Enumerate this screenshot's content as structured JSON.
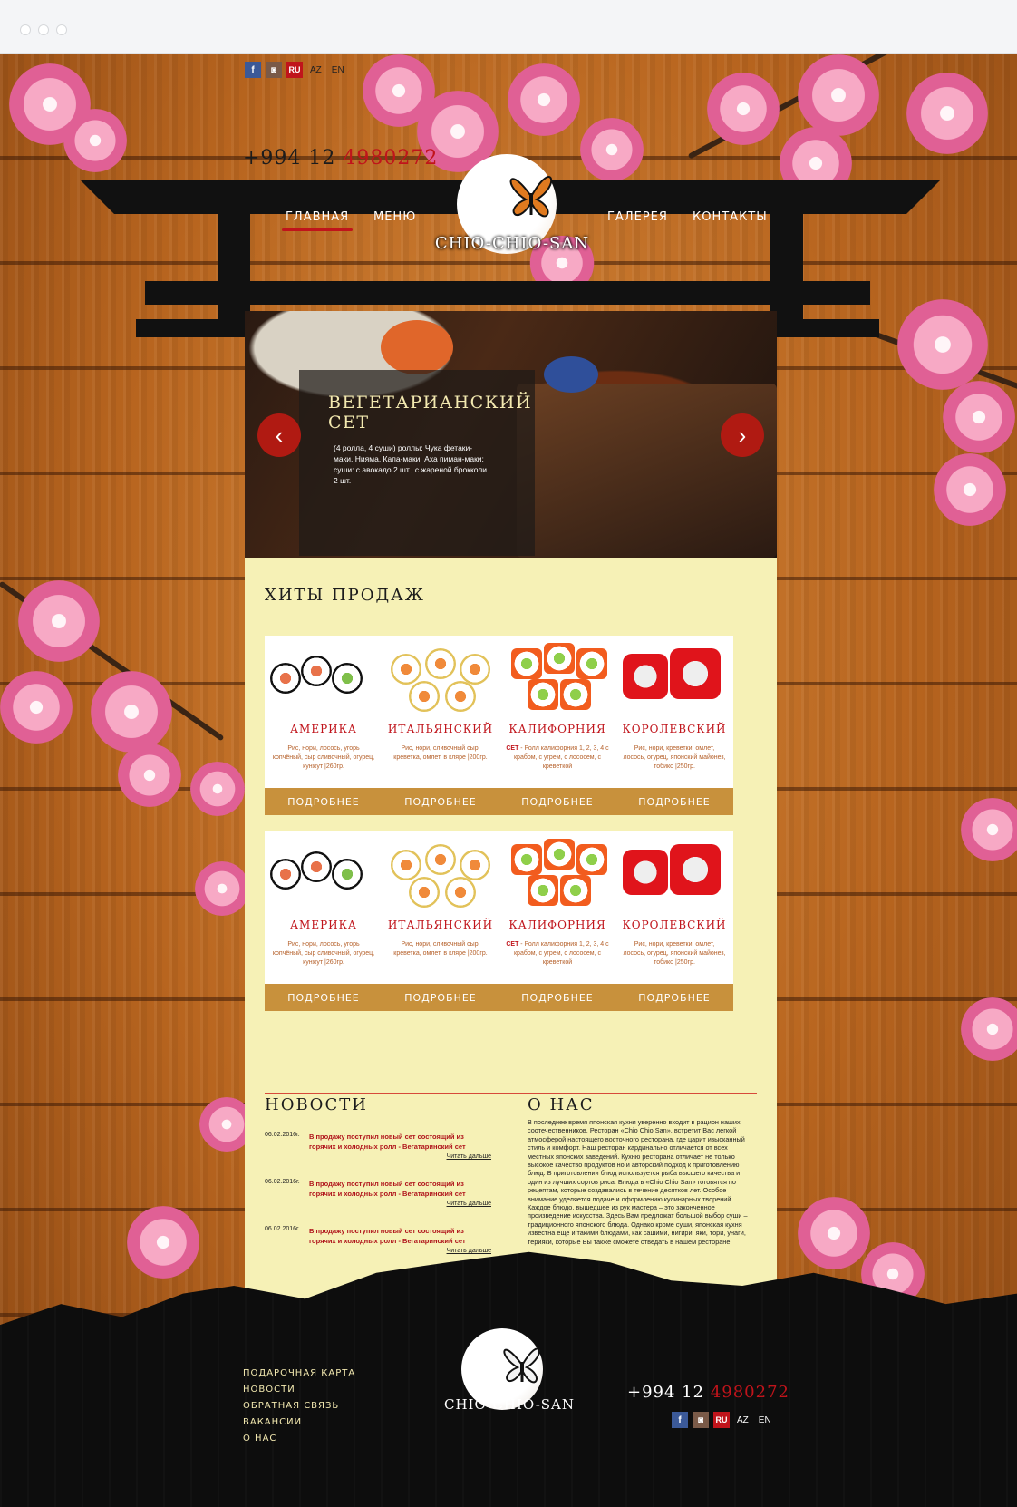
{
  "header": {
    "social": [
      "f",
      "◙"
    ],
    "languages": [
      "RU",
      "AZ",
      "EN"
    ],
    "phone_prefix": "+994 12",
    "phone_number": "4980272",
    "brand": "CHIO-CHIO-SAN",
    "nav": [
      "ГЛАВНАЯ",
      "МЕНЮ",
      "ГАЛЕРЕЯ",
      "КОНТАКТЫ"
    ]
  },
  "slider": {
    "title": "ВЕГЕТАРИАНСКИЙ СЕТ",
    "description": "(4 ролла, 4 суши) роллы: Чука фетаки-маки, Нияма, Капа-маки, Аха пиман-маки; суши: с авокадо 2 шт., с жареной брокколи 2 шт.",
    "prev_icon": "‹",
    "next_icon": "›"
  },
  "bestsellers": {
    "title": "ХИТЫ ПРОДАЖ",
    "button_label": "ПОДРОБНЕЕ",
    "items": [
      {
        "name": "АМЕРИКА",
        "desc": "Рис, нори, лосось, угорь копчёный, сыр сливочный, огурец, кунжут |260гр."
      },
      {
        "name": "ИТАЛЬЯНСКИЙ",
        "desc": "Рис, нори, сливочный сыр, креветка, омлет, в кляре |200гр."
      },
      {
        "name": "КАЛИФОРНИЯ",
        "desc_bold": "СЕТ",
        "desc": " - Ролл калифорния 1, 2, 3, 4 с крабом, с угрем, с лососем, с креветкой"
      },
      {
        "name": "КОРОЛЕВСКИЙ",
        "desc": "Рис, нори, креветки, омлет, лосось, огурец, японский майонез, тобико |250гр."
      }
    ]
  },
  "news": {
    "title": "НОВОСТИ",
    "more_label": "Читать дальше",
    "items": [
      {
        "date": "06.02.2016г.",
        "text": "В продажу поступил новый сет состоящий из горячих и холодных ролл - Вегатаринский сет"
      },
      {
        "date": "06.02.2016г.",
        "text": "В продажу поступил новый сет состоящий из горячих и холодных ролл - Вегатаринский сет"
      },
      {
        "date": "06.02.2016г.",
        "text": "В продажу поступил новый сет состоящий из горячих и холодных ролл - Вегатаринский сет"
      }
    ]
  },
  "about": {
    "title": "О НАС",
    "text": "В последнее время японская кухня уверенно входит в рацион наших соотечественников. Ресторан «Chio Chio San», встретит Вас легкой атмосферой настоящего восточного ресторана, где царит изысканный стиль и комфорт. Наш ресторан кардинально отличается от всех местных японских заведений. Кухню ресторана отличает не только высокое качество продуктов но и авторский подход к приготовлению блюд. В приготовлении блюд используется рыба высшего качества и один из лучших сортов риса. Блюда в «Chio Chio San» готовятся по рецептам, которые создавались в течение десятков лет. Особое внимание уделяется подаче и оформлению кулинарных творений. Каждое блюдо, вышедшее из рук мастера – это законченное произведение искусства. Здесь Вам предложат большой выбор суши – традиционного японского блюда. Однако кроме суши, японская кухня известна еще и такими блюдами, как сашими, нигири, яки, тори, унаги, терияки, которые Вы также сможете отведать в нашем ресторане."
  },
  "footer": {
    "links": [
      "ПОДАРОЧНАЯ КАРТА",
      "НОВОСТИ",
      "ОБРАТНАЯ СВЯЗЬ",
      "ВАКАНСИИ",
      "О НАС"
    ],
    "brand": "CHIO-CHIO-SAN",
    "phone_prefix": "+994 12",
    "phone_number": "4980272"
  }
}
